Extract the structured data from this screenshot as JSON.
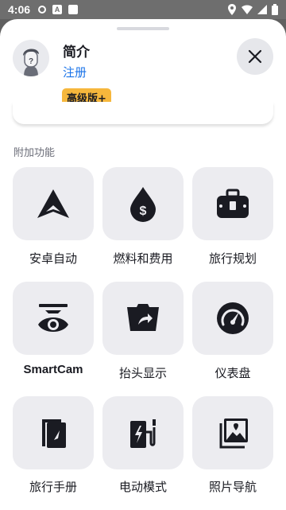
{
  "status_bar": {
    "time": "4:06",
    "notif_a": "A"
  },
  "profile": {
    "title": "简介",
    "register_label": "注册",
    "premium_label": "高级版+"
  },
  "section": {
    "label": "附加功能"
  },
  "features": [
    {
      "label": "安卓自动",
      "icon": "android-auto-icon"
    },
    {
      "label": "燃料和费用",
      "icon": "fuel-drop-icon"
    },
    {
      "label": "旅行规划",
      "icon": "suitcase-icon"
    },
    {
      "label": "SmartCam",
      "icon": "smartcam-eye-icon"
    },
    {
      "label": "抬头显示",
      "icon": "head-up-display-icon"
    },
    {
      "label": "仪表盘",
      "icon": "speedometer-icon"
    },
    {
      "label": "旅行手册",
      "icon": "travel-book-icon"
    },
    {
      "label": "电动模式",
      "icon": "ev-charger-icon"
    },
    {
      "label": "照片导航",
      "icon": "photo-navigation-icon"
    }
  ],
  "colors": {
    "accent": "#1a73e8",
    "premium": "#f6b73c",
    "tile": "#ececf0",
    "icon": "#1a1b22"
  }
}
